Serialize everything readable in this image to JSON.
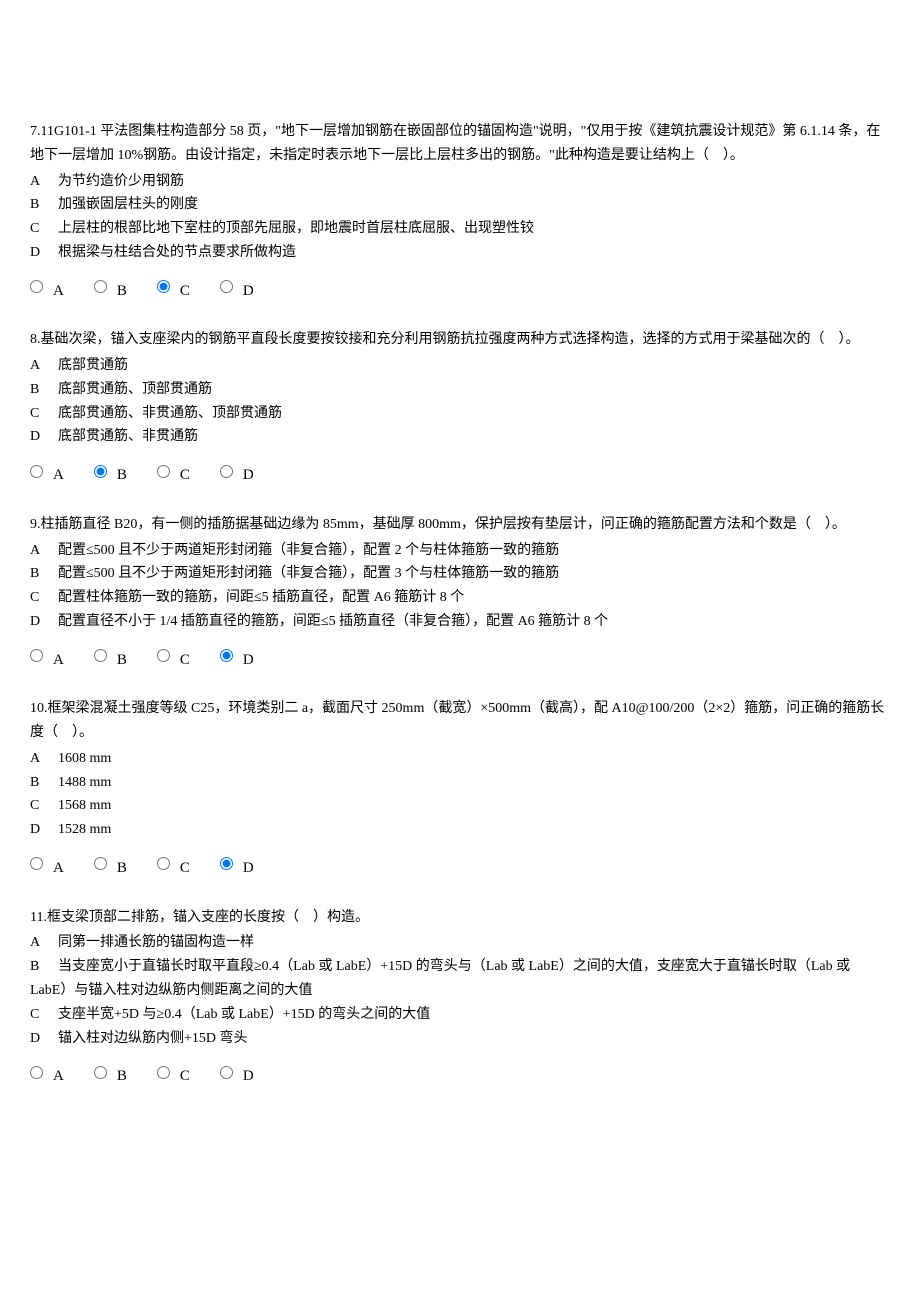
{
  "questions": [
    {
      "stem": "7.11G101-1 平法图集柱构造部分 58 页，\"地下一层增加钢筋在嵌固部位的锚固构造\"说明，\"仅用于按《建筑抗震设计规范》第 6.1.14 条，在地下一层增加 10%钢筋。由设计指定，未指定时表示地下一层比上层柱多出的钢筋。\"此种构造是要让结构上（　）。",
      "options": [
        {
          "letter": "A",
          "text": "为节约造价少用钢筋"
        },
        {
          "letter": "B",
          "text": "加强嵌固层柱头的刚度"
        },
        {
          "letter": "C",
          "text": "上层柱的根部比地下室柱的顶部先屈服，即地震时首层柱底屈服、出现塑性铰"
        },
        {
          "letter": "D",
          "text": "根据梁与柱结合处的节点要求所做构造"
        }
      ],
      "radios": [
        "A",
        "B",
        "C",
        "D"
      ],
      "selected": "C"
    },
    {
      "stem": "8.基础次梁，锚入支座梁内的钢筋平直段长度要按铰接和充分利用钢筋抗拉强度两种方式选择构造，选择的方式用于梁基础次的（　）。",
      "options": [
        {
          "letter": "A",
          "text": "底部贯通筋"
        },
        {
          "letter": "B",
          "text": "底部贯通筋、顶部贯通筋"
        },
        {
          "letter": "C",
          "text": "底部贯通筋、非贯通筋、顶部贯通筋"
        },
        {
          "letter": "D",
          "text": "底部贯通筋、非贯通筋"
        }
      ],
      "radios": [
        "A",
        "B",
        "C",
        "D"
      ],
      "selected": "B"
    },
    {
      "stem": "9.柱插筋直径 B20，有一侧的插筋据基础边缘为 85mm，基础厚 800mm，保护层按有垫层计，问正确的箍筋配置方法和个数是（　）。",
      "options": [
        {
          "letter": "A",
          "text": "配置≤500 且不少于两道矩形封闭箍（非复合箍），配置 2 个与柱体箍筋一致的箍筋"
        },
        {
          "letter": "B",
          "text": "配置≤500 且不少于两道矩形封闭箍（非复合箍），配置 3 个与柱体箍筋一致的箍筋"
        },
        {
          "letter": "C",
          "text": "配置柱体箍筋一致的箍筋，间距≤5 插筋直径，配置 A6 箍筋计 8 个"
        },
        {
          "letter": "D",
          "text": "配置直径不小于 1/4 插筋直径的箍筋，间距≤5 插筋直径（非复合箍），配置 A6 箍筋计 8 个"
        }
      ],
      "radios": [
        "A",
        "B",
        "C",
        "D"
      ],
      "selected": "D"
    },
    {
      "stem": "10.框架梁混凝土强度等级 C25，环境类别二 a，截面尺寸 250mm（截宽）×500mm（截高），配 A10@100/200（2×2）箍筋，问正确的箍筋长度（　）。",
      "options": [
        {
          "letter": "A",
          "text": "1608 mm"
        },
        {
          "letter": "B",
          "text": "1488 mm"
        },
        {
          "letter": "C",
          "text": "1568 mm"
        },
        {
          "letter": "D",
          "text": "1528 mm"
        }
      ],
      "radios": [
        "A",
        "B",
        "C",
        "D"
      ],
      "selected": "D"
    },
    {
      "stem": "11.框支梁顶部二排筋，锚入支座的长度按（　）构造。",
      "options": [
        {
          "letter": "A",
          "text": "同第一排通长筋的锚固构造一样"
        },
        {
          "letter": "B",
          "text": "当支座宽小于直锚长时取平直段≥0.4（Lab 或 LabE）+15D 的弯头与（Lab 或 LabE）之间的大值，支座宽大于直锚长时取（Lab 或 LabE）与锚入柱对边纵筋内侧距离之间的大值"
        },
        {
          "letter": "C",
          "text": "支座半宽+5D 与≥0.4（Lab 或 LabE）+15D 的弯头之间的大值"
        },
        {
          "letter": "D",
          "text": "锚入柱对边纵筋内侧+15D 弯头"
        }
      ],
      "radios": [
        "A",
        "B",
        "C",
        "D"
      ],
      "selected": null
    }
  ]
}
